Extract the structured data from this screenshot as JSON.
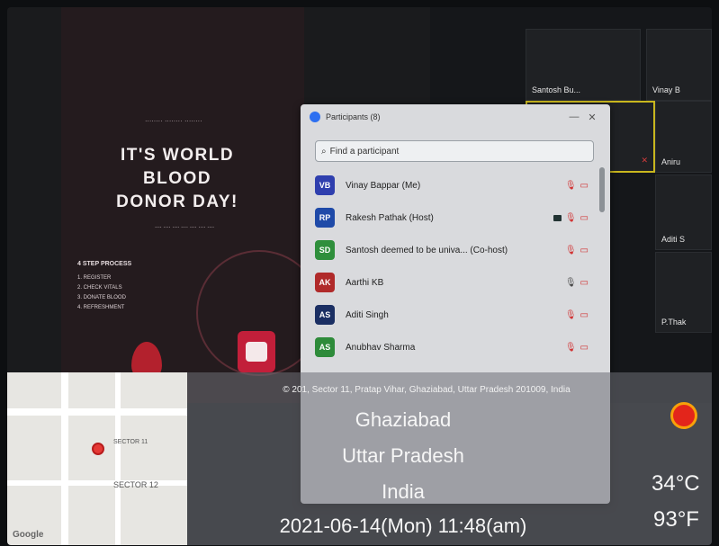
{
  "slide": {
    "headline_lines": [
      "IT'S WORLD",
      "BLOOD",
      "DONOR DAY!"
    ],
    "steps_title": "4 STEP PROCESS",
    "steps": [
      "1. REGISTER",
      "2. CHECK VITALS",
      "3. DONATE BLOOD",
      "4. REFRESHMENT"
    ]
  },
  "grid": {
    "tiles": [
      {
        "name": "Vinay B"
      },
      {
        "name": "Santosh Bu..."
      },
      {
        "name": "Aniru"
      },
      {
        "name": "Aditi S"
      },
      {
        "name": "P.Thak"
      }
    ]
  },
  "participants": {
    "title": "Participants (8)",
    "search_placeholder": "Find a participant",
    "rows": [
      {
        "initials": "VB",
        "name": "Vinay Bappar (Me)",
        "color": "#2f3fae"
      },
      {
        "initials": "RP",
        "name": "Rakesh Pathak (Host)",
        "color": "#1f4aa8"
      },
      {
        "initials": "SD",
        "name": "Santosh deemed to be univa... (Co-host)",
        "color": "#2f8f3c"
      },
      {
        "initials": "AK",
        "name": "Aarthi KB",
        "color": "#b02a2a"
      },
      {
        "initials": "AS",
        "name": "Aditi Singh",
        "color": "#1b2f63"
      },
      {
        "initials": "AS",
        "name": "Anubhav Sharma",
        "color": "#2e8b3a"
      }
    ]
  },
  "overlay": {
    "address": "© 201, Sector 11, Pratap Vihar, Ghaziabad, Uttar Pradesh 201009, India",
    "city": "Ghaziabad",
    "state": "Uttar Pradesh",
    "country": "India",
    "datetime": "2021-06-14(Mon)  11:48(am)",
    "temp_c": "34°C",
    "temp_f": "93°F"
  },
  "map": {
    "labels": [
      "SECTOR 11",
      "SECTOR 12"
    ],
    "google": "Google"
  }
}
